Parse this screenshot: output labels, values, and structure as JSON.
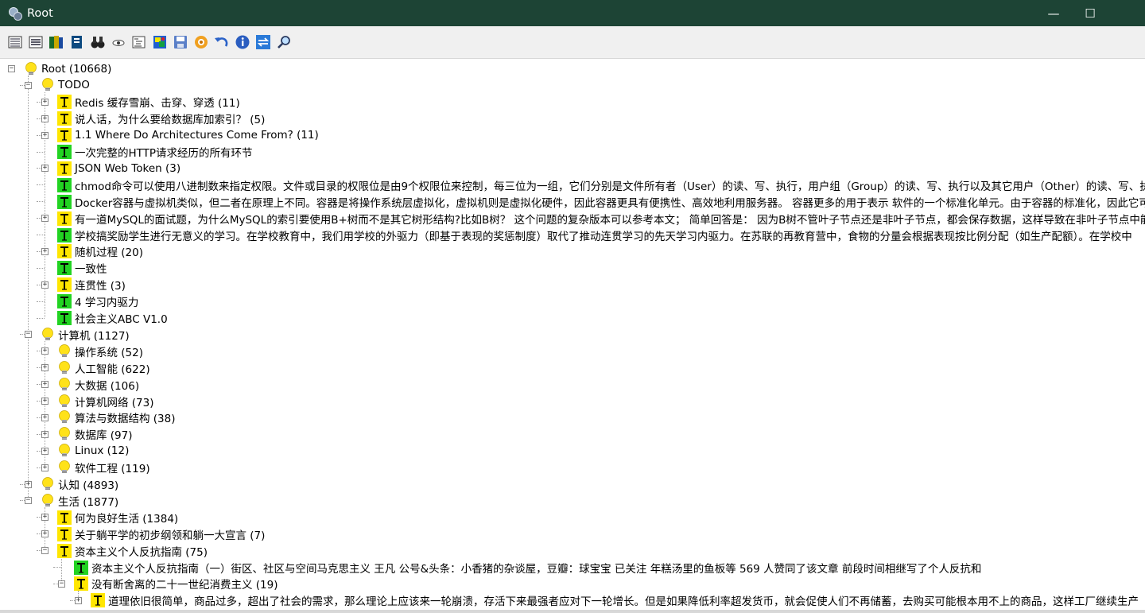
{
  "window": {
    "title": "Root",
    "minimize": "—",
    "maximize": "☐"
  },
  "toolbar": {
    "buttons": [
      {
        "name": "list-view-icon",
        "kind": "lines"
      },
      {
        "name": "detail-view-icon",
        "kind": "detail"
      },
      {
        "name": "books-icon",
        "kind": "books"
      },
      {
        "name": "book-icon",
        "kind": "book"
      },
      {
        "name": "binoculars-icon",
        "kind": "binoculars"
      },
      {
        "name": "eye-icon",
        "kind": "eye"
      },
      {
        "name": "outline-icon",
        "kind": "outline"
      },
      {
        "name": "image-icon",
        "kind": "image"
      },
      {
        "name": "save-icon",
        "kind": "save"
      },
      {
        "name": "gear-icon",
        "kind": "gear"
      },
      {
        "name": "undo-icon",
        "kind": "undo"
      },
      {
        "name": "info-icon",
        "kind": "info"
      },
      {
        "name": "sync-icon",
        "kind": "sync"
      },
      {
        "name": "search-icon",
        "kind": "search"
      }
    ]
  },
  "tree": {
    "rows": [
      {
        "label": "Root (10668)",
        "depth": 0,
        "icon": "bulb",
        "exp": "minus"
      },
      {
        "label": "TODO",
        "depth": 1,
        "icon": "bulb",
        "exp": "minus"
      },
      {
        "label": "Redis 缓存雪崩、击穿、穿透 (11)",
        "depth": 2,
        "icon": "note",
        "exp": "plus"
      },
      {
        "label": "说人话，为什么要给数据库加索引？ (5)",
        "depth": 2,
        "icon": "note",
        "exp": "plus"
      },
      {
        "label": "1.1 Where Do Architectures Come From? (11)",
        "depth": 2,
        "icon": "note",
        "exp": "plus"
      },
      {
        "label": "一次完整的HTTP请求经历的所有环节",
        "depth": 2,
        "icon": "leaf",
        "exp": "none"
      },
      {
        "label": "JSON Web Token (3)",
        "depth": 2,
        "icon": "note",
        "exp": "plus"
      },
      {
        "label": "chmod命令可以使用八进制数来指定权限。文件或目录的权限位是由9个权限位来控制，每三位为一组，它们分别是文件所有者（User）的读、写、执行，用户组（Group）的读、写、执行以及其它用户（Other）的读、写、执行。",
        "depth": 2,
        "icon": "leaf",
        "exp": "none"
      },
      {
        "label": "Docker容器与虚拟机类似，但二者在原理上不同。容器是将操作系统层虚拟化，虚拟机则是虚拟化硬件，因此容器更具有便携性、高效地利用服务器。 容器更多的用于表示 软件的一个标准化单元。由于容器的标准化，因此它可以无视基础设施的差异",
        "depth": 2,
        "icon": "leaf",
        "exp": "none"
      },
      {
        "label": "有一道MySQL的面试题，为什么MySQL的索引要使用B+树而不是其它树形结构?比如B树？ 这个问题的复杂版本可以参考本文； 简单回答是： 因为B树不管叶子节点还是非叶子节点，都会保存数据，这样导致在非叶子节点中能保存的指针数量变少",
        "depth": 2,
        "icon": "note",
        "exp": "plus"
      },
      {
        "label": "学校搞奖励学生进行无意义的学习。在学校教育中，我们用学校的外驱力（即基于表现的奖惩制度）取代了推动连贯学习的先天学习内驱力。在苏联的再教育营中，食物的分量会根据表现按比例分配（如生产配额）。在学校中",
        "depth": 2,
        "icon": "leaf",
        "exp": "none"
      },
      {
        "label": "随机过程 (20)",
        "depth": 2,
        "icon": "note",
        "exp": "plus"
      },
      {
        "label": "一致性",
        "depth": 2,
        "icon": "leaf",
        "exp": "none"
      },
      {
        "label": "连贯性 (3)",
        "depth": 2,
        "icon": "note",
        "exp": "plus"
      },
      {
        "label": "4 学习内驱力",
        "depth": 2,
        "icon": "leaf",
        "exp": "none"
      },
      {
        "label": "社会主义ABC V1.0",
        "depth": 2,
        "icon": "leaf",
        "exp": "none"
      },
      {
        "label": "计算机 (1127)",
        "depth": 1,
        "icon": "bulb",
        "exp": "minus"
      },
      {
        "label": "操作系统 (52)",
        "depth": 2,
        "icon": "bulb",
        "exp": "plus"
      },
      {
        "label": "人工智能 (622)",
        "depth": 2,
        "icon": "bulb",
        "exp": "plus"
      },
      {
        "label": "大数据 (106)",
        "depth": 2,
        "icon": "bulb",
        "exp": "plus"
      },
      {
        "label": "计算机网络 (73)",
        "depth": 2,
        "icon": "bulb",
        "exp": "plus"
      },
      {
        "label": "算法与数据结构 (38)",
        "depth": 2,
        "icon": "bulb",
        "exp": "plus"
      },
      {
        "label": "数据库 (97)",
        "depth": 2,
        "icon": "bulb",
        "exp": "plus"
      },
      {
        "label": "Linux (12)",
        "depth": 2,
        "icon": "bulb",
        "exp": "plus"
      },
      {
        "label": "软件工程 (119)",
        "depth": 2,
        "icon": "bulb",
        "exp": "plus"
      },
      {
        "label": "认知 (4893)",
        "depth": 1,
        "icon": "bulb",
        "exp": "plus"
      },
      {
        "label": "生活 (1877)",
        "depth": 1,
        "icon": "bulb",
        "exp": "minus"
      },
      {
        "label": "何为良好生活 (1384)",
        "depth": 2,
        "icon": "note",
        "exp": "plus"
      },
      {
        "label": "关于躺平学的初步纲领和躺一大宣言 (7)",
        "depth": 2,
        "icon": "note",
        "exp": "plus"
      },
      {
        "label": "资本主义个人反抗指南 (75)",
        "depth": 2,
        "icon": "note",
        "exp": "minus"
      },
      {
        "label": "资本主义个人反抗指南（一）街区、社区与空间马克思主义  王凡 公号&头条：小香猪的杂谈屋，豆瓣：球宝宝 已关注 年糕汤里的鱼板等 569 人赞同了该文章 前段时间相继写了个人反抗和",
        "depth": 3,
        "icon": "leaf",
        "exp": "none"
      },
      {
        "label": "没有断舍离的二十一世纪消费主义 (19)",
        "depth": 3,
        "icon": "note",
        "exp": "minus"
      },
      {
        "label": "道理依旧很简单，商品过多，超出了社会的需求，那么理论上应该来一轮崩溃，存活下来最强者应对下一轮增长。但是如果降低利率超发货币，就会促使人们不再储蓄，去购买可能根本用不上的商品，这样工厂继续生产",
        "depth": 4,
        "icon": "note",
        "exp": "plus"
      }
    ]
  },
  "colors": {
    "titlebar": "#1d4435",
    "bulb": "#ffe21a",
    "note": "#ffe600",
    "leaf": "#22d322"
  }
}
